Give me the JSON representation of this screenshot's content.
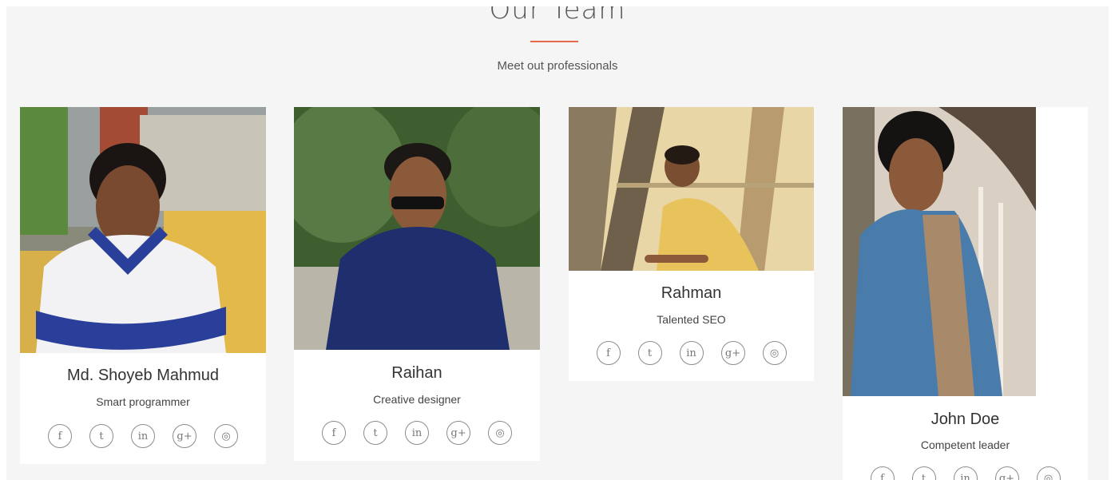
{
  "section": {
    "title": "Our Team",
    "subtitle": "Meet out professionals",
    "accent": "#e8684a"
  },
  "members": [
    {
      "name": "Md. Shoyeb Mahmud",
      "role": "Smart programmer"
    },
    {
      "name": "Raihan",
      "role": "Creative designer"
    },
    {
      "name": "Rahman",
      "role": "Talented SEO"
    },
    {
      "name": "John Doe",
      "role": "Competent leader"
    }
  ],
  "social_icons": [
    "facebook-icon",
    "twitter-icon",
    "linkedin-icon",
    "google-plus-icon",
    "dribbble-icon"
  ],
  "social_glyphs": {
    "facebook": "f",
    "twitter": "t",
    "linkedin": "in",
    "google_plus": "g+",
    "dribbble": "◎"
  }
}
